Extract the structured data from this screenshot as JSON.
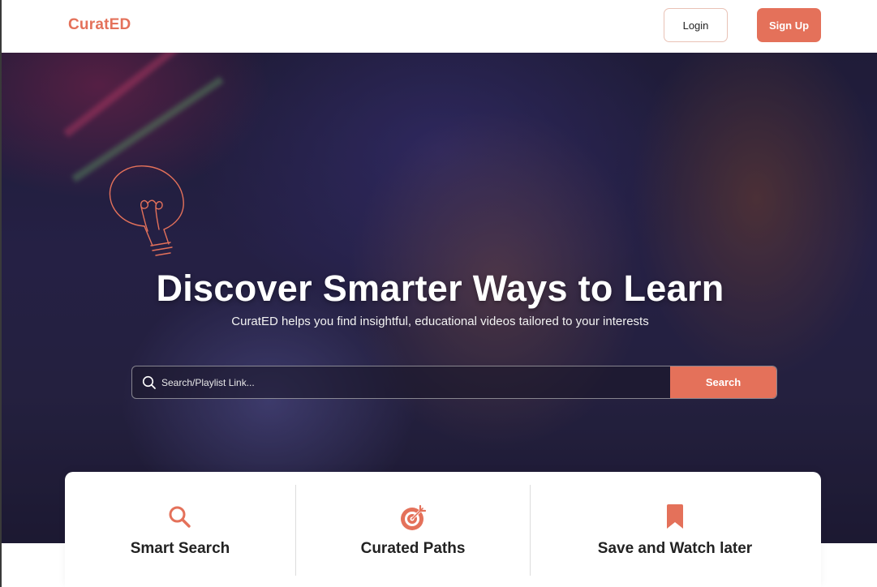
{
  "header": {
    "brand": "CuratED",
    "login_label": "Login",
    "signup_label": "Sign Up"
  },
  "hero": {
    "title": "Discover Smarter Ways to Learn",
    "subtitle": "CuratED helps you find insightful,  educational videos tailored to your interests",
    "search_placeholder": "Search/Playlist Link...",
    "search_value": "",
    "search_button": "Search"
  },
  "features": [
    {
      "label": "Smart Search",
      "icon": "magnifier-icon"
    },
    {
      "label": "Curated Paths",
      "icon": "target-icon"
    },
    {
      "label": "Save and Watch later",
      "icon": "bookmark-icon"
    }
  ],
  "colors": {
    "accent": "#e4715a",
    "text_dark": "#222222",
    "white": "#ffffff"
  }
}
